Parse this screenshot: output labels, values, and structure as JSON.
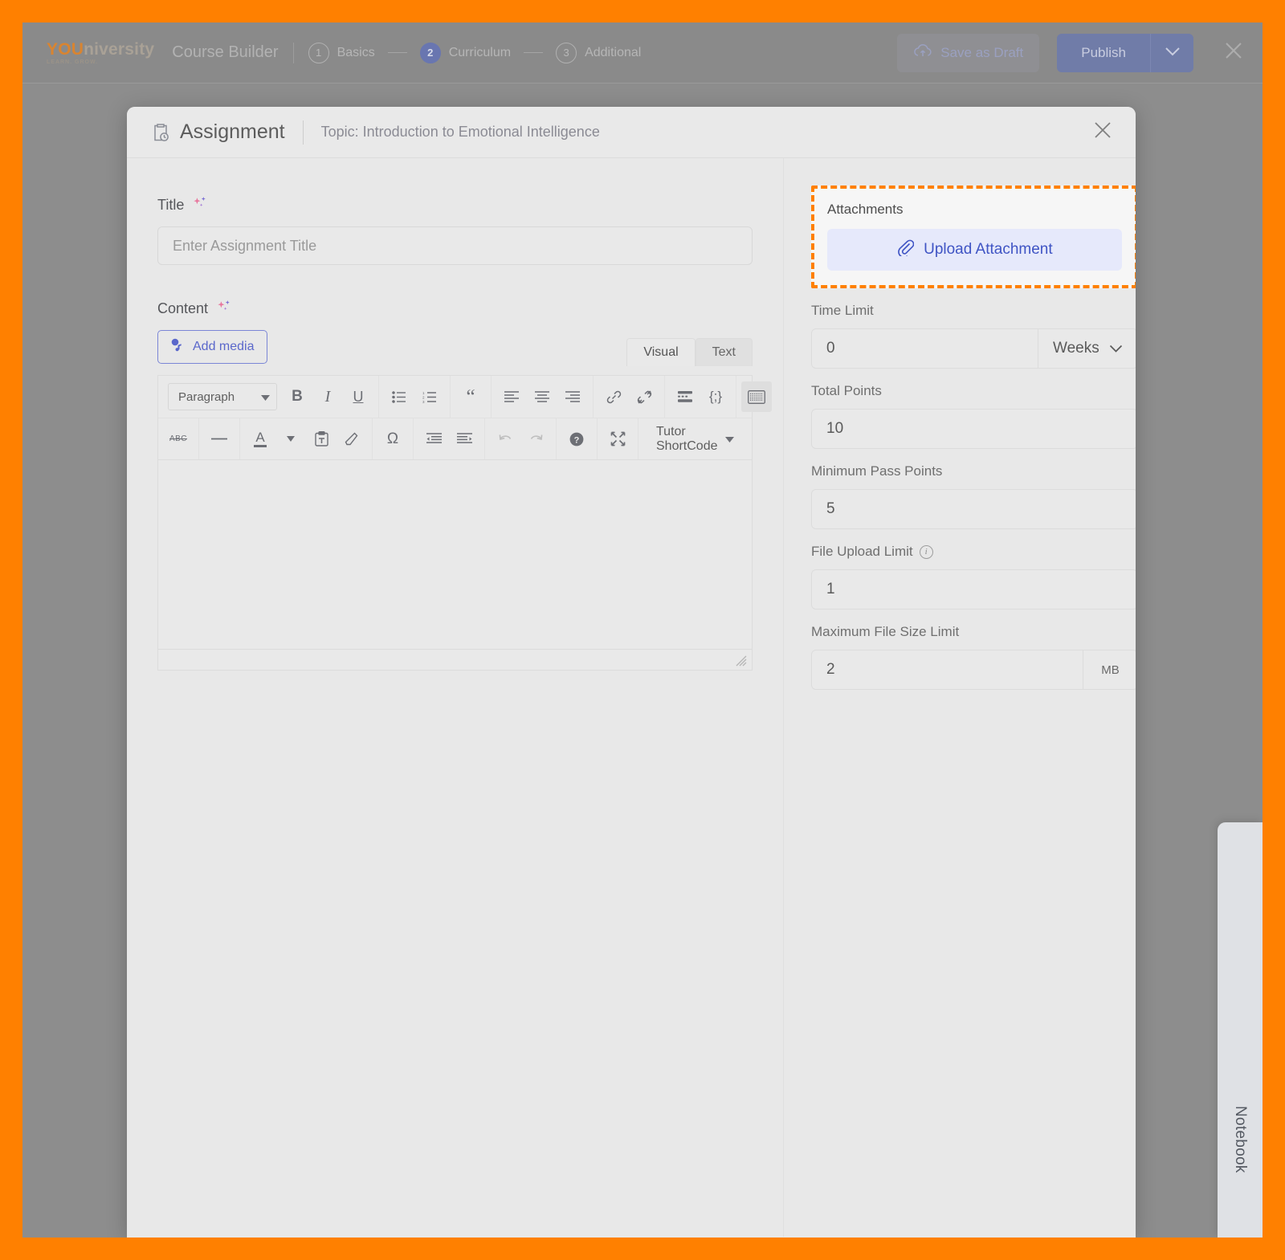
{
  "app_header": {
    "logo_primary": "YOU",
    "logo_secondary": "niversity",
    "logo_tagline": "LEARN. GROW.",
    "product_title": "Course Builder",
    "steps": [
      {
        "number": "1",
        "label": "Basics",
        "active": false
      },
      {
        "number": "2",
        "label": "Curriculum",
        "active": true
      },
      {
        "number": "3",
        "label": "Additional",
        "active": false
      }
    ],
    "save_draft_label": "Save as Draft",
    "save_draft_icon": "cloud-upload-icon",
    "publish_label": "Publish",
    "publish_caret_icon": "chevron-down-icon",
    "close_icon": "close-icon"
  },
  "modal": {
    "icon": "clipboard-clock-icon",
    "title": "Assignment",
    "topic": "Topic: Introduction to Emotional Intelligence",
    "close_icon": "close-icon"
  },
  "left_pane": {
    "title_field": {
      "label": "Title",
      "ai_icon": "sparkles-icon",
      "placeholder": "Enter Assignment Title",
      "value": ""
    },
    "content_field": {
      "label": "Content",
      "ai_icon": "sparkles-icon",
      "add_media_label": "Add media",
      "add_media_icon": "media-icon",
      "tabs": [
        {
          "label": "Visual",
          "active": true
        },
        {
          "label": "Text",
          "active": false
        }
      ],
      "toolbar_row1": [
        {
          "name": "paragraph-format-select",
          "label": "Paragraph",
          "type": "select"
        },
        {
          "name": "bold-button",
          "label": "B",
          "type": "icon"
        },
        {
          "name": "italic-button",
          "label": "I",
          "type": "icon"
        },
        {
          "name": "underline-button",
          "label": "U",
          "type": "icon"
        },
        {
          "name": "bulleted-list-button",
          "label": "",
          "type": "icon"
        },
        {
          "name": "numbered-list-button",
          "label": "",
          "type": "icon"
        },
        {
          "name": "blockquote-button",
          "label": "“",
          "type": "icon"
        },
        {
          "name": "align-left-button",
          "label": "",
          "type": "icon"
        },
        {
          "name": "align-center-button",
          "label": "",
          "type": "icon"
        },
        {
          "name": "align-right-button",
          "label": "",
          "type": "icon"
        },
        {
          "name": "insert-link-button",
          "label": "",
          "type": "icon"
        },
        {
          "name": "remove-link-button",
          "label": "",
          "type": "icon"
        },
        {
          "name": "read-more-button",
          "label": "",
          "type": "icon"
        },
        {
          "name": "code-button",
          "label": "{;}",
          "type": "icon"
        },
        {
          "name": "toggle-toolbar-button",
          "label": "",
          "type": "icon"
        }
      ],
      "toolbar_row2": [
        {
          "name": "strikethrough-button",
          "label": "ABC",
          "type": "icon"
        },
        {
          "name": "horizontal-rule-button",
          "label": "—",
          "type": "icon"
        },
        {
          "name": "text-color-button",
          "label": "A",
          "type": "icon"
        },
        {
          "name": "paste-as-text-button",
          "label": "",
          "type": "icon"
        },
        {
          "name": "clear-formatting-button",
          "label": "",
          "type": "icon"
        },
        {
          "name": "special-character-button",
          "label": "Ω",
          "type": "icon"
        },
        {
          "name": "outdent-button",
          "label": "",
          "type": "icon"
        },
        {
          "name": "indent-button",
          "label": "",
          "type": "icon"
        },
        {
          "name": "undo-button",
          "label": "",
          "type": "icon"
        },
        {
          "name": "redo-button",
          "label": "",
          "type": "icon"
        },
        {
          "name": "keyboard-shortcuts-button",
          "label": "?",
          "type": "icon"
        },
        {
          "name": "fullscreen-button",
          "label": "",
          "type": "icon"
        },
        {
          "name": "tutor-shortcode-dropdown",
          "label": "Tutor ShortCode",
          "type": "dropdown"
        }
      ],
      "body_value": ""
    }
  },
  "right_pane": {
    "attachments": {
      "label": "Attachments",
      "upload_label": "Upload Attachment",
      "upload_icon": "paperclip-icon",
      "highlighted": true,
      "highlight_color": "#ff8000"
    },
    "fields": [
      {
        "name": "time-limit",
        "label": "Time Limit",
        "value": "0",
        "unit": "Weeks",
        "unit_icon": "chevron-down-icon",
        "has_unit_dropdown": true,
        "has_info": false
      },
      {
        "name": "total-points",
        "label": "Total Points",
        "value": "10",
        "unit": "",
        "has_unit_dropdown": false,
        "has_info": false
      },
      {
        "name": "minimum-pass-points",
        "label": "Minimum Pass Points",
        "value": "5",
        "unit": "",
        "has_unit_dropdown": false,
        "has_info": false
      },
      {
        "name": "file-upload-limit",
        "label": "File Upload Limit",
        "value": "1",
        "unit": "",
        "has_unit_dropdown": false,
        "has_info": true,
        "info_icon": "info-icon"
      },
      {
        "name": "maximum-file-size-limit",
        "label": "Maximum File Size Limit",
        "value": "2",
        "unit": "MB",
        "has_unit_dropdown": false,
        "has_unit_suffix": true,
        "has_info": false
      }
    ]
  },
  "notebook": {
    "label": "Notebook"
  }
}
